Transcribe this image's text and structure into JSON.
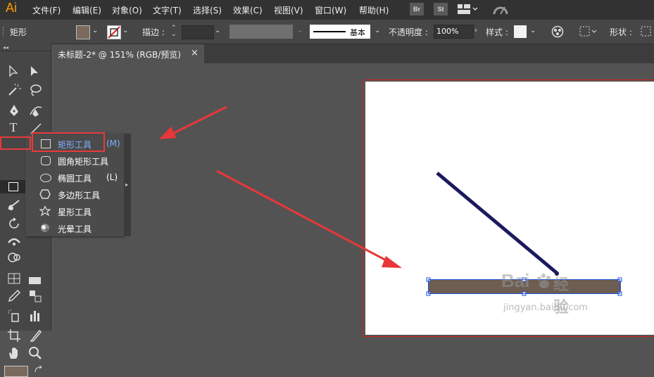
{
  "app": {
    "logo": "Ai"
  },
  "menubar": {
    "items": [
      "文件(F)",
      "编辑(E)",
      "对象(O)",
      "文字(T)",
      "选择(S)",
      "效果(C)",
      "视图(V)",
      "窗口(W)",
      "帮助(H)"
    ],
    "icons": {
      "bridge": "Br",
      "stock": "St"
    }
  },
  "control_bar": {
    "tool_name": "矩形",
    "stroke_label": "描边 :",
    "stroke_style": "基本",
    "opacity_label": "不透明度 :",
    "opacity_value": "100%",
    "style_label": "样式 :",
    "shape_label": "形状 :",
    "fill_color": "#7d6a5c",
    "colors": {
      "bar_bg": "#464646",
      "menubar_bg": "#323232"
    }
  },
  "document_tab": {
    "title": "未标题-2* @ 151% (RGB/预览)",
    "close_glyph": "×"
  },
  "tools_panel": {
    "collapse_glyph": "◂◂"
  },
  "flyout": {
    "items": [
      {
        "label": "矩形工具",
        "shortcut": "(M)",
        "icon": "rectangle-icon"
      },
      {
        "label": "圆角矩形工具",
        "shortcut": "",
        "icon": "rounded-rectangle-icon"
      },
      {
        "label": "椭圆工具",
        "shortcut": "(L)",
        "icon": "ellipse-icon"
      },
      {
        "label": "多边形工具",
        "shortcut": "",
        "icon": "polygon-icon"
      },
      {
        "label": "星形工具",
        "shortcut": "",
        "icon": "star-icon"
      },
      {
        "label": "光晕工具",
        "shortcut": "",
        "icon": "flare-icon"
      }
    ],
    "highlight_color": "#e83a3a"
  },
  "canvas": {
    "line_color": "#1b1a5e",
    "rect_fill": "#6e5e52",
    "selection_color": "#1f4fe0",
    "arrow_color": "#e8373a"
  },
  "watermark": {
    "brand_left": "Bai",
    "brand_right": "经验",
    "url": "jingyan.baidu.com"
  }
}
